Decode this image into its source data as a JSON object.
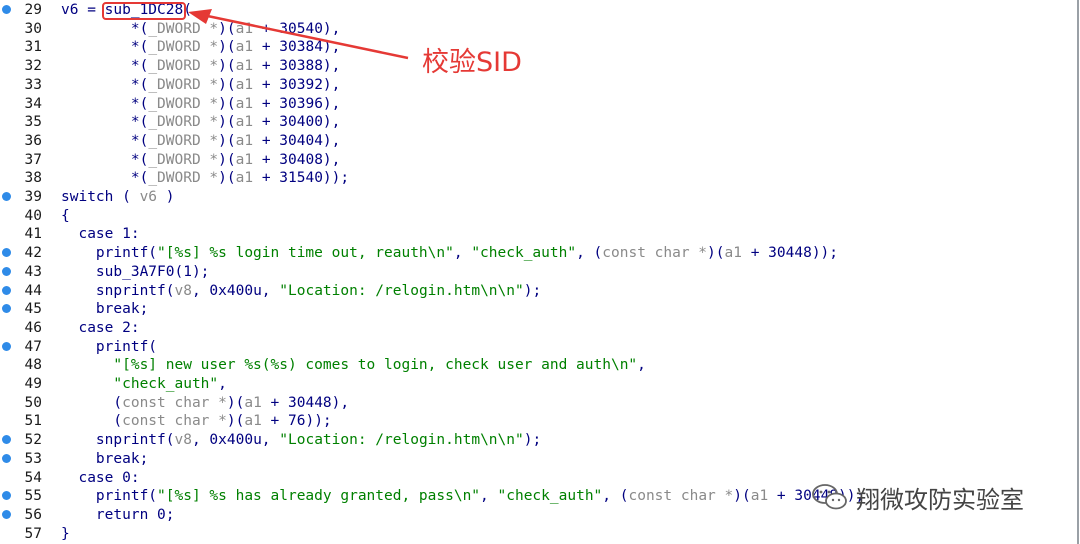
{
  "annotation": {
    "label": "校验SID",
    "color": "#e53935"
  },
  "watermark": {
    "text": "翔微攻防实验室"
  },
  "lines": [
    {
      "n": "29",
      "bp": true,
      "parts": [
        [
          "k",
          "v6 = "
        ],
        [
          "k",
          "sub_1DC28"
        ],
        [
          "k",
          "("
        ]
      ]
    },
    {
      "n": "30",
      "bp": false,
      "parts": [
        [
          "k",
          "        *("
        ],
        [
          "g",
          "_DWORD *"
        ],
        [
          "k",
          ")("
        ],
        [
          "g",
          "a1"
        ],
        [
          "k",
          " + 30540),"
        ]
      ]
    },
    {
      "n": "31",
      "bp": false,
      "parts": [
        [
          "k",
          "        *("
        ],
        [
          "g",
          "_DWORD *"
        ],
        [
          "k",
          ")("
        ],
        [
          "g",
          "a1"
        ],
        [
          "k",
          " + 30384),"
        ]
      ]
    },
    {
      "n": "32",
      "bp": false,
      "parts": [
        [
          "k",
          "        *("
        ],
        [
          "g",
          "_DWORD *"
        ],
        [
          "k",
          ")("
        ],
        [
          "g",
          "a1"
        ],
        [
          "k",
          " + 30388),"
        ]
      ]
    },
    {
      "n": "33",
      "bp": false,
      "parts": [
        [
          "k",
          "        *("
        ],
        [
          "g",
          "_DWORD *"
        ],
        [
          "k",
          ")("
        ],
        [
          "g",
          "a1"
        ],
        [
          "k",
          " + 30392),"
        ]
      ]
    },
    {
      "n": "34",
      "bp": false,
      "parts": [
        [
          "k",
          "        *("
        ],
        [
          "g",
          "_DWORD *"
        ],
        [
          "k",
          ")("
        ],
        [
          "g",
          "a1"
        ],
        [
          "k",
          " + 30396),"
        ]
      ]
    },
    {
      "n": "35",
      "bp": false,
      "parts": [
        [
          "k",
          "        *("
        ],
        [
          "g",
          "_DWORD *"
        ],
        [
          "k",
          ")("
        ],
        [
          "g",
          "a1"
        ],
        [
          "k",
          " + 30400),"
        ]
      ]
    },
    {
      "n": "36",
      "bp": false,
      "parts": [
        [
          "k",
          "        *("
        ],
        [
          "g",
          "_DWORD *"
        ],
        [
          "k",
          ")("
        ],
        [
          "g",
          "a1"
        ],
        [
          "k",
          " + 30404),"
        ]
      ]
    },
    {
      "n": "37",
      "bp": false,
      "parts": [
        [
          "k",
          "        *("
        ],
        [
          "g",
          "_DWORD *"
        ],
        [
          "k",
          ")("
        ],
        [
          "g",
          "a1"
        ],
        [
          "k",
          " + 30408),"
        ]
      ]
    },
    {
      "n": "38",
      "bp": false,
      "parts": [
        [
          "k",
          "        *("
        ],
        [
          "g",
          "_DWORD *"
        ],
        [
          "k",
          ")("
        ],
        [
          "g",
          "a1"
        ],
        [
          "k",
          " + 31540));"
        ]
      ]
    },
    {
      "n": "39",
      "bp": true,
      "parts": [
        [
          "k",
          "switch ( "
        ],
        [
          "g",
          "v6"
        ],
        [
          "k",
          " )"
        ]
      ]
    },
    {
      "n": "40",
      "bp": false,
      "parts": [
        [
          "k",
          "{"
        ]
      ]
    },
    {
      "n": "41",
      "bp": false,
      "parts": [
        [
          "k",
          "  case 1:"
        ]
      ]
    },
    {
      "n": "42",
      "bp": true,
      "parts": [
        [
          "k",
          "    printf("
        ],
        [
          "s",
          "\"[%s] %s login time out, reauth\\n\""
        ],
        [
          "k",
          ", "
        ],
        [
          "s",
          "\"check_auth\""
        ],
        [
          "k",
          ", ("
        ],
        [
          "g",
          "const char *"
        ],
        [
          "k",
          ")("
        ],
        [
          "g",
          "a1"
        ],
        [
          "k",
          " + 30448));"
        ]
      ]
    },
    {
      "n": "43",
      "bp": true,
      "parts": [
        [
          "k",
          "    sub_3A7F0(1);"
        ]
      ]
    },
    {
      "n": "44",
      "bp": true,
      "parts": [
        [
          "k",
          "    snprintf("
        ],
        [
          "g",
          "v8"
        ],
        [
          "k",
          ", 0x400u, "
        ],
        [
          "s",
          "\"Location: /relogin.htm\\n\\n\""
        ],
        [
          "k",
          ");"
        ]
      ]
    },
    {
      "n": "45",
      "bp": true,
      "parts": [
        [
          "k",
          "    break;"
        ]
      ]
    },
    {
      "n": "46",
      "bp": false,
      "parts": [
        [
          "k",
          "  case 2:"
        ]
      ]
    },
    {
      "n": "47",
      "bp": true,
      "parts": [
        [
          "k",
          "    printf("
        ]
      ]
    },
    {
      "n": "48",
      "bp": false,
      "parts": [
        [
          "s",
          "      \"[%s] new user %s(%s) comes to login, check user and auth\\n\""
        ],
        [
          "k",
          ","
        ]
      ]
    },
    {
      "n": "49",
      "bp": false,
      "parts": [
        [
          "s",
          "      \"check_auth\""
        ],
        [
          "k",
          ","
        ]
      ]
    },
    {
      "n": "50",
      "bp": false,
      "parts": [
        [
          "k",
          "      ("
        ],
        [
          "g",
          "const char *"
        ],
        [
          "k",
          ")("
        ],
        [
          "g",
          "a1"
        ],
        [
          "k",
          " + 30448),"
        ]
      ]
    },
    {
      "n": "51",
      "bp": false,
      "parts": [
        [
          "k",
          "      ("
        ],
        [
          "g",
          "const char *"
        ],
        [
          "k",
          ")("
        ],
        [
          "g",
          "a1"
        ],
        [
          "k",
          " + 76));"
        ]
      ]
    },
    {
      "n": "52",
      "bp": true,
      "parts": [
        [
          "k",
          "    snprintf("
        ],
        [
          "g",
          "v8"
        ],
        [
          "k",
          ", 0x400u, "
        ],
        [
          "s",
          "\"Location: /relogin.htm\\n\\n\""
        ],
        [
          "k",
          ");"
        ]
      ]
    },
    {
      "n": "53",
      "bp": true,
      "parts": [
        [
          "k",
          "    break;"
        ]
      ]
    },
    {
      "n": "54",
      "bp": false,
      "parts": [
        [
          "k",
          "  case 0:"
        ]
      ]
    },
    {
      "n": "55",
      "bp": true,
      "parts": [
        [
          "k",
          "    printf("
        ],
        [
          "s",
          "\"[%s] %s has already granted, pass\\n\""
        ],
        [
          "k",
          ", "
        ],
        [
          "s",
          "\"check_auth\""
        ],
        [
          "k",
          ", ("
        ],
        [
          "g",
          "const char *"
        ],
        [
          "k",
          ")("
        ],
        [
          "g",
          "a1"
        ],
        [
          "k",
          " + 30448));"
        ]
      ]
    },
    {
      "n": "56",
      "bp": true,
      "parts": [
        [
          "k",
          "    return 0;"
        ]
      ]
    },
    {
      "n": "57",
      "bp": false,
      "parts": [
        [
          "k",
          "}"
        ]
      ]
    }
  ]
}
